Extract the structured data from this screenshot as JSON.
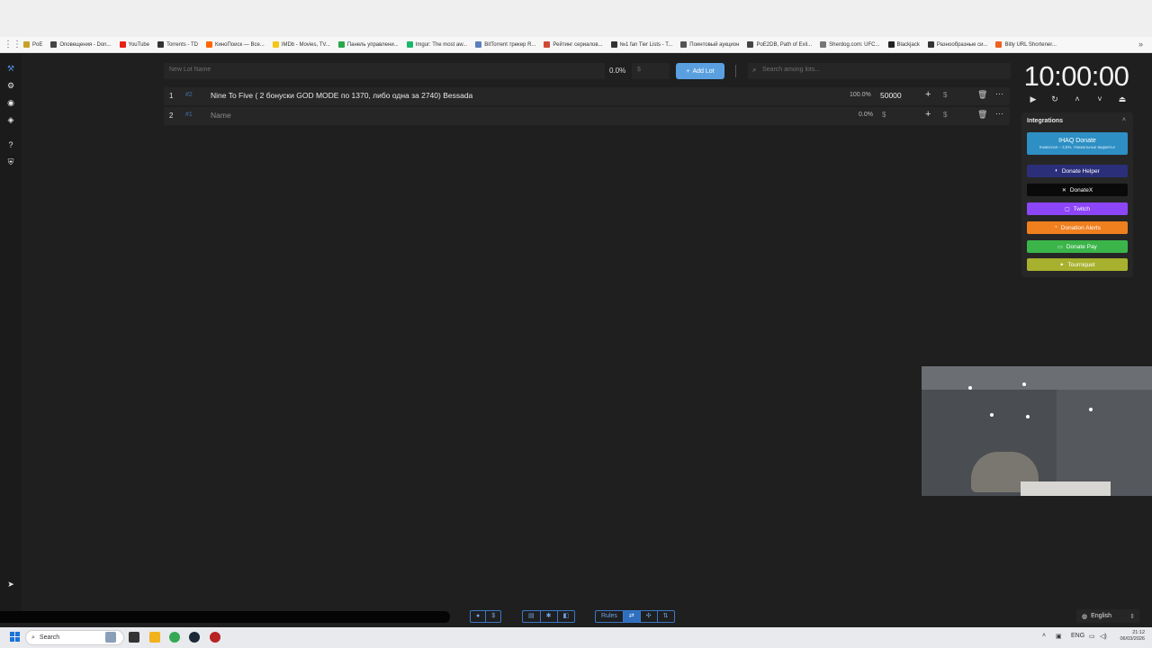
{
  "bookmarks": [
    {
      "label": "PoE",
      "color": "#c9a227"
    },
    {
      "label": "Оповещения - Don...",
      "color": "#444444"
    },
    {
      "label": "YouTube",
      "color": "#e62117"
    },
    {
      "label": "Torrents - TD",
      "color": "#333333"
    },
    {
      "label": "КиноПоиск — Все...",
      "color": "#ff6600"
    },
    {
      "label": "IMDb - Movies, TV...",
      "color": "#f5c518"
    },
    {
      "label": "Панель управлени...",
      "color": "#2ba84a"
    },
    {
      "label": "Imgur: The most aw...",
      "color": "#1bb76e"
    },
    {
      "label": "BitTorrent трекер R...",
      "color": "#5b7fbf"
    },
    {
      "label": "Рейтинг сериалов...",
      "color": "#d14836"
    },
    {
      "label": "№1 fan Tier Lists - T...",
      "color": "#333333"
    },
    {
      "label": "Пoинтовый аукцион",
      "color": "#555555"
    },
    {
      "label": "PoE2DB, Path of Exil...",
      "color": "#444444"
    },
    {
      "label": "Sherdog.com: UFC...",
      "color": "#777777"
    },
    {
      "label": "Blackjack",
      "color": "#222222"
    },
    {
      "label": "Разнообразные си...",
      "color": "#333333"
    },
    {
      "label": "Bitly URL Shortener...",
      "color": "#ee6123"
    }
  ],
  "lot_form": {
    "name_placeholder": "New Lot Name",
    "percent": "0.0%",
    "amount_placeholder": "$",
    "add_label": "Add Lot",
    "search_placeholder": "Search among lots..."
  },
  "lots": [
    {
      "index": "1",
      "id": "#2",
      "name": "Nine To Five ( 2 бонуски GOD MODE по 1370, либо одна за 2740) Bessada",
      "percent": "100.0%",
      "amount": "50000",
      "currency": "$"
    },
    {
      "index": "2",
      "id": "#1",
      "name": "Name",
      "percent": "0.0%",
      "amount": "$",
      "currency": "$"
    }
  ],
  "timer": {
    "value": "10:00:00"
  },
  "integrations": {
    "title": "Integrations",
    "ihaq_title": "IHAQ Donate",
    "ihaq_sub": "Комиссия – 3,5%. Уникальные виджеты!",
    "items": [
      {
        "label": "Donate Helper",
        "color": "#2b2f7a"
      },
      {
        "label": "DonateX",
        "color": "#0a0a0a"
      },
      {
        "label": "Twitch",
        "color": "#8c45f7"
      },
      {
        "label": "Donation Alerts",
        "color": "#f07f1e"
      },
      {
        "label": "Donate Pay",
        "color": "#3bb54a"
      },
      {
        "label": "Tourniquet",
        "color": "#a7b12d"
      }
    ]
  },
  "toolbar": {
    "rules_label": "Rules"
  },
  "language": {
    "label": "English"
  },
  "taskbar": {
    "search_label": "Search",
    "lang": "ENG",
    "time": "21:12",
    "date": "06/03/2026"
  }
}
